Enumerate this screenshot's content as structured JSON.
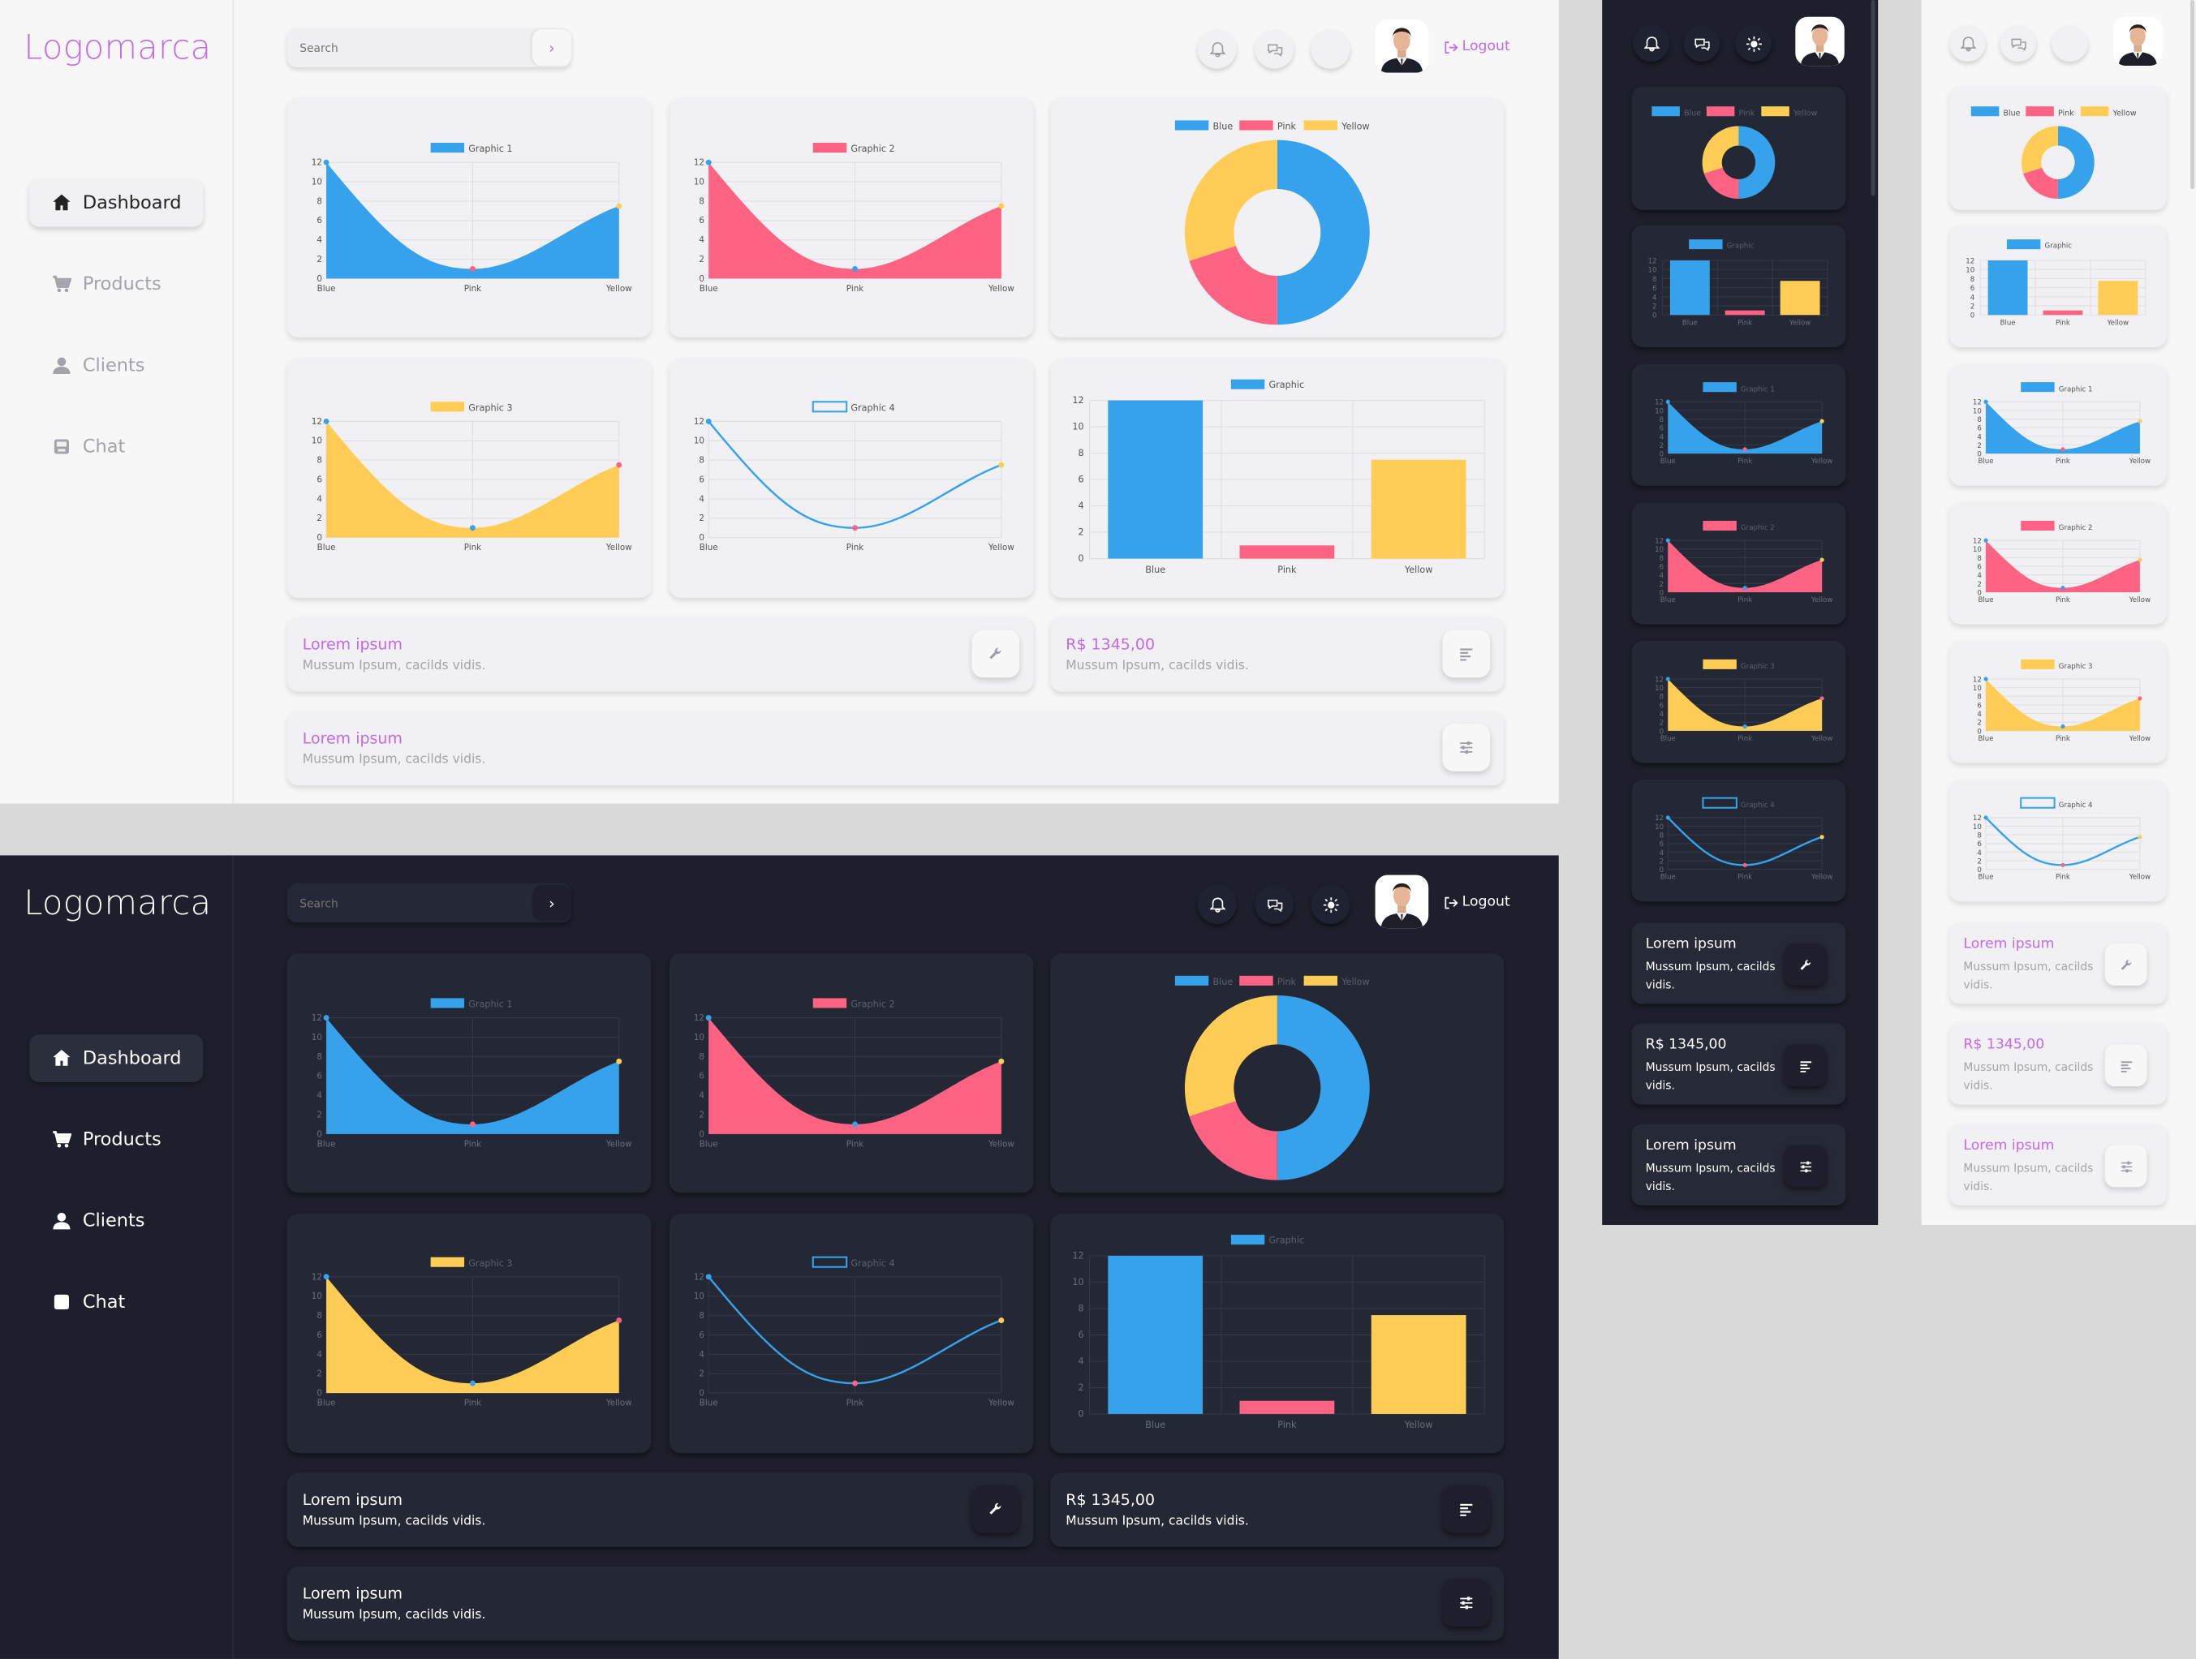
{
  "brand": "Logomarca",
  "nav": [
    {
      "key": "dashboard",
      "label": "Dashboard",
      "icon": "home-icon"
    },
    {
      "key": "products",
      "label": "Products",
      "icon": "cart-icon"
    },
    {
      "key": "clients",
      "label": "Clients",
      "icon": "user-icon"
    },
    {
      "key": "chat",
      "label": "Chat",
      "icon": "inbox-icon"
    }
  ],
  "search": {
    "placeholder": "Search",
    "go_icon": "chevron-right-icon"
  },
  "header": {
    "logout_label": "Logout",
    "icons": [
      "bell-icon",
      "chat-bubbles-icon",
      "moon-icon",
      "sun-icon",
      "avatar"
    ]
  },
  "colors": {
    "blue": "#36a2eb",
    "pink": "#ff6384",
    "yellow": "#ffcd56",
    "accent": "#c469e8",
    "dark_bg": "#1d202c",
    "light_bg": "#f7f7f8"
  },
  "chart_data": [
    {
      "type": "area",
      "title": "Graphic 1",
      "categories": [
        "Blue",
        "Pink",
        "Yellow"
      ],
      "values": [
        12,
        1,
        7.5
      ],
      "ylim": [
        0,
        12
      ],
      "yticks": [
        0,
        2,
        4,
        6,
        8,
        10,
        12
      ],
      "color": "#36a2eb"
    },
    {
      "type": "area",
      "title": "Graphic 2",
      "categories": [
        "Blue",
        "Pink",
        "Yellow"
      ],
      "values": [
        12,
        1,
        7.5
      ],
      "ylim": [
        0,
        12
      ],
      "yticks": [
        0,
        2,
        4,
        6,
        8,
        10,
        12
      ],
      "color": "#ff6384"
    },
    {
      "type": "pie",
      "legend": [
        "Blue",
        "Pink",
        "Yellow"
      ],
      "values": [
        50,
        20,
        30
      ],
      "colors": [
        "#36a2eb",
        "#ff6384",
        "#ffcd56"
      ]
    },
    {
      "type": "area",
      "title": "Graphic 3",
      "categories": [
        "Blue",
        "Pink",
        "Yellow"
      ],
      "values": [
        12,
        1,
        7.5
      ],
      "ylim": [
        0,
        12
      ],
      "yticks": [
        0,
        2,
        4,
        6,
        8,
        10,
        12
      ],
      "color": "#ffcd56"
    },
    {
      "type": "line",
      "title": "Graphic 4",
      "categories": [
        "Blue",
        "Pink",
        "Yellow"
      ],
      "values": [
        12,
        1,
        7.5
      ],
      "ylim": [
        0,
        12
      ],
      "yticks": [
        0,
        2,
        4,
        6,
        8,
        10,
        12
      ],
      "color": "#36a2eb"
    },
    {
      "type": "bar",
      "title": "Graphic",
      "categories": [
        "Blue",
        "Pink",
        "Yellow"
      ],
      "values": [
        12,
        1,
        7.5
      ],
      "ylim": [
        0,
        12
      ],
      "yticks": [
        0,
        2,
        4,
        6,
        8,
        10,
        12
      ],
      "colors": [
        "#36a2eb",
        "#ff6384",
        "#ffcd56"
      ]
    }
  ],
  "info_cards": [
    {
      "title": "Lorem ipsum",
      "subtitle": "Mussum Ipsum, cacilds vidis.",
      "icon": "wrench-icon"
    },
    {
      "title": "R$ 1345,00",
      "subtitle": "Mussum Ipsum, cacilds vidis.",
      "icon": "align-left-icon"
    },
    {
      "title": "Lorem ipsum",
      "subtitle": "Mussum Ipsum, cacilds vidis.",
      "icon": "sliders-icon"
    }
  ]
}
